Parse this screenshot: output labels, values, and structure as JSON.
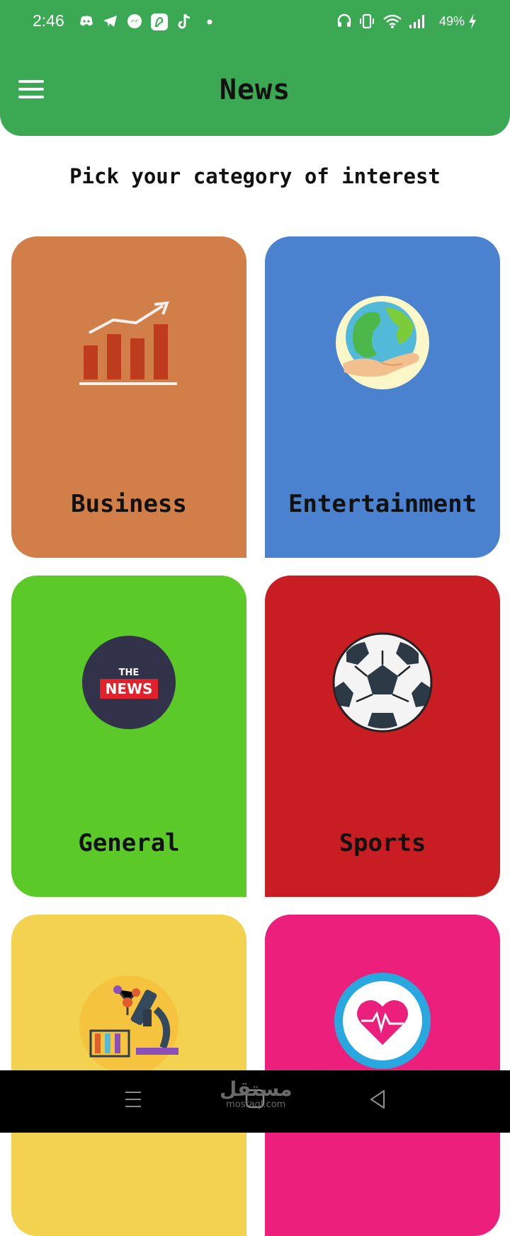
{
  "status_bar": {
    "time": "2:46",
    "battery_percent": "49%",
    "notification_icons": [
      "discord-icon",
      "telegram-icon",
      "messenger-icon",
      "app-icon",
      "tiktok-icon",
      "dot-icon"
    ],
    "system_icons": [
      "headset-icon",
      "vibrate-icon",
      "wifi-icon",
      "signal-icon",
      "charging-icon"
    ]
  },
  "app_bar": {
    "title": "News",
    "menu_icon": "hamburger-menu-icon",
    "color": "#3ba853"
  },
  "subtitle": "Pick your category of interest",
  "categories": [
    {
      "label": "Business",
      "color": "#d17e48",
      "icon": "bar-chart-growth-icon"
    },
    {
      "label": "Entertainment",
      "color": "#4a82cf",
      "icon": "globe-hands-icon"
    },
    {
      "label": "General",
      "color": "#5bca28",
      "icon": "the-news-badge-icon"
    },
    {
      "label": "Sports",
      "color": "#c81d23",
      "icon": "soccer-ball-icon"
    },
    {
      "label": "",
      "color": "#f3d24f",
      "icon": "science-microscope-icon"
    },
    {
      "label": "",
      "color": "#ec1f7c",
      "icon": "heart-health-icon"
    }
  ],
  "news_badge": {
    "top": "THE",
    "bottom": "NEWS"
  },
  "nav_bar": {
    "buttons": [
      "recent-apps-icon",
      "home-icon",
      "back-icon"
    ]
  },
  "watermark": {
    "arabic": "مستقل",
    "latin": "mostaql.com"
  }
}
